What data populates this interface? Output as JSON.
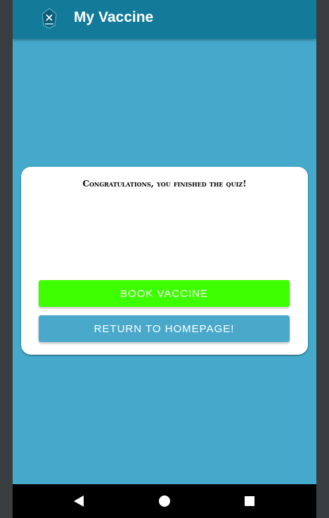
{
  "app_bar": {
    "title": "My Vaccine",
    "logo_icon": "vaccine-logo-icon",
    "color": "#147a99"
  },
  "screen": {
    "background_color": "#45a9cb"
  },
  "card": {
    "message": "Congratulations, you finished the quiz!",
    "buttons": {
      "book_label": "Book vaccine",
      "return_label": "Return to homepage!",
      "book_color": "#3dff00",
      "return_color": "#4aa9cb"
    }
  },
  "nav": {
    "back_icon": "back-triangle-icon",
    "home_icon": "home-circle-icon",
    "recent_icon": "recent-apps-square-icon"
  }
}
